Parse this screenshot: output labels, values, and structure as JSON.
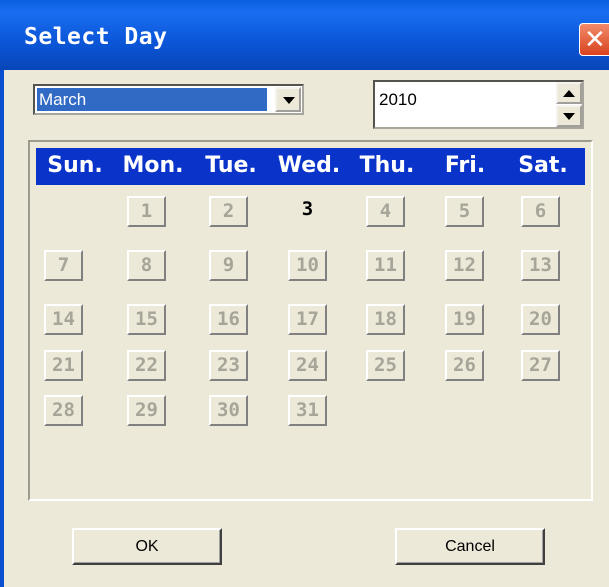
{
  "window": {
    "title": "Select Day",
    "close_glyph": "✕"
  },
  "month_select": {
    "value": "March"
  },
  "year_spinner": {
    "value": "2010"
  },
  "calendar": {
    "weekdays": [
      "Sun.",
      "Mon.",
      "Tue.",
      "Wed.",
      "Thu.",
      "Fri.",
      "Sat."
    ],
    "selected_day": "3",
    "weeks": [
      [
        "",
        "1",
        "2",
        "3",
        "4",
        "5",
        "6"
      ],
      [
        "7",
        "8",
        "9",
        "10",
        "11",
        "12",
        "13"
      ],
      [
        "14",
        "15",
        "16",
        "17",
        "18",
        "19",
        "20"
      ],
      [
        "21",
        "22",
        "23",
        "24",
        "25",
        "26",
        "27"
      ],
      [
        "28",
        "29",
        "30",
        "31",
        "",
        "",
        ""
      ]
    ]
  },
  "buttons": {
    "ok": "OK",
    "cancel": "Cancel"
  },
  "colors": {
    "title_bar": "#0b56d8",
    "header_row": "#0a33c9",
    "selection": "#316ac5",
    "close_button": "#d8431e"
  }
}
